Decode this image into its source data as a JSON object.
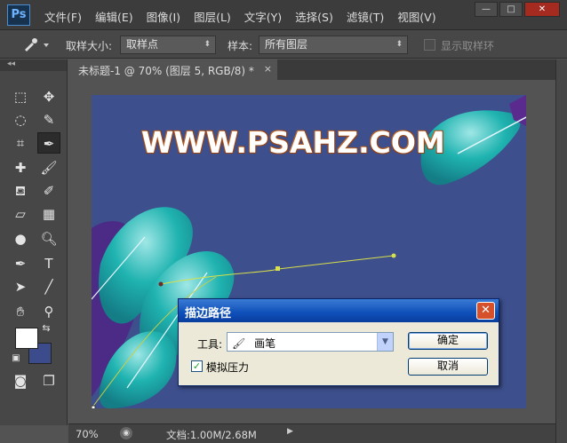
{
  "app": {
    "logo": "Ps",
    "menus": [
      "文件(F)",
      "编辑(E)",
      "图像(I)",
      "图层(L)",
      "文字(Y)",
      "选择(S)",
      "滤镜(T)",
      "视图(V)"
    ],
    "window_controls": [
      "—",
      "□",
      "✕"
    ]
  },
  "options_bar": {
    "sample_size_label": "取样大小:",
    "sample_size_value": "取样点",
    "sample_label": "样本:",
    "sample_value": "所有图层",
    "show_ring_label": "显示取样环"
  },
  "document_tab": {
    "title": "未标题-1 @ 70% (图层 5, RGB/8) *",
    "close": "×"
  },
  "toolbox": {
    "collapse": "◂◂",
    "tools": [
      "marquee-icon",
      "move-icon",
      "lasso-icon",
      "quick-select-icon",
      "crop-icon",
      "eyedropper-icon",
      "healing-icon",
      "brush-icon",
      "stamp-icon",
      "history-brush-icon",
      "eraser-icon",
      "gradient-icon",
      "blur-icon",
      "dodge-icon",
      "pen-icon",
      "type-icon",
      "path-select-icon",
      "line-icon",
      "hand-icon",
      "zoom-icon"
    ],
    "colors": {
      "foreground": "#ffffff",
      "background": "#3c4b8c"
    }
  },
  "canvas": {
    "headline": "WWW.PSAHZ.COM",
    "colors": {
      "background": "#3d4f8c",
      "teal": "#1fb3b0",
      "purple": "#5b2a8e"
    }
  },
  "status_bar": {
    "zoom": "70%",
    "doc_info": "文档:1.00M/2.68M"
  },
  "dialog": {
    "title": "描边路径",
    "close": "✕",
    "tool_label": "工具:",
    "tool_value": "画笔",
    "simulate_pressure_label": "模拟压力",
    "simulate_pressure_checked": true,
    "ok_label": "确定",
    "cancel_label": "取消"
  }
}
